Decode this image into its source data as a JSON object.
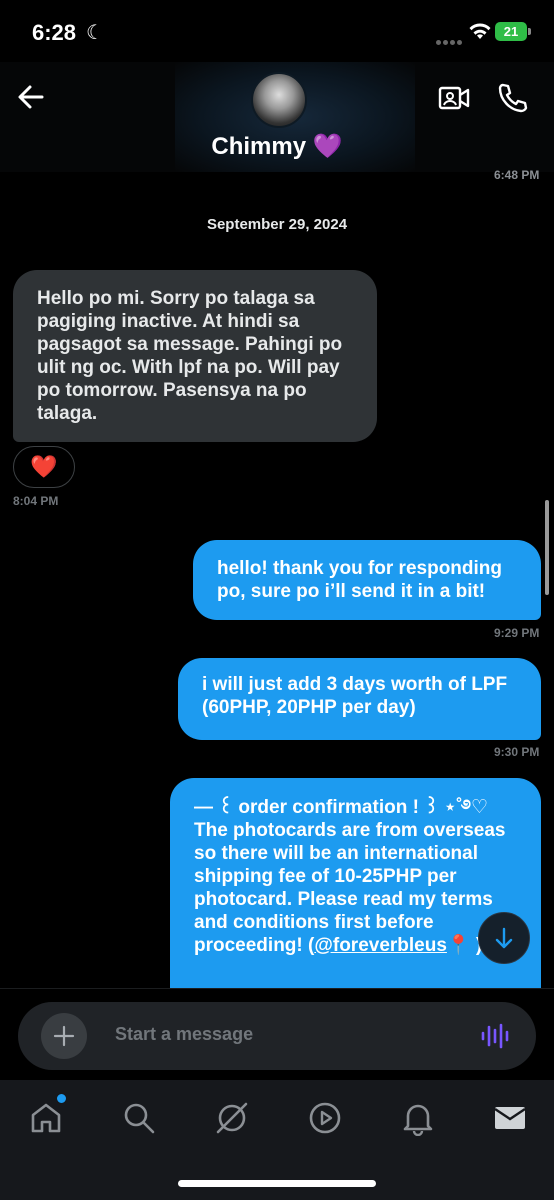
{
  "status_bar": {
    "time": "6:28",
    "moon_glyph": "☾",
    "battery": "21"
  },
  "header": {
    "contact_name": "Chimmy 💜",
    "prev_message_time": "6:48 PM",
    "icons": [
      "back-arrow-icon",
      "video-call-icon",
      "phone-call-icon"
    ]
  },
  "chat": {
    "date_separator": "September 29, 2024",
    "messages": [
      {
        "direction": "incoming",
        "text": "Hello po mi. Sorry po talaga sa pagiging inactive. At hindi sa pagsagot sa message. Pahingi po ulit ng oc. With lpf na po. Will pay po tomorrow. Pasensya na po talaga.",
        "reaction": "❤️",
        "time": "8:04 PM"
      },
      {
        "direction": "outgoing",
        "text": "hello! thank you for responding po, sure po i’ll send it in a bit!",
        "time": "9:29 PM"
      },
      {
        "direction": "outgoing",
        "text": "i will just add 3 days worth of LPF (60PHP, 20PHP per day)",
        "time": "9:30 PM"
      },
      {
        "direction": "outgoing",
        "text_before_link": "— ꒰ order confirmation ! ꒱ ⋆˚࿔♡ The photocards are from overseas so there will be an international shipping fee of 10-25PHP per photocard. Please read my terms and conditions first before proceeding! (",
        "link": "@foreverbleus",
        "text_after_link": "📍 )"
      }
    ]
  },
  "composer": {
    "placeholder": "Start a message"
  },
  "tabbar": {
    "items": [
      "home-icon",
      "search-icon",
      "grok-icon",
      "video-icon",
      "notifications-icon",
      "messages-icon"
    ]
  },
  "colors": {
    "outgoing_bubble": "#1d9bf0",
    "incoming_bubble": "#2f3336",
    "background": "#000000",
    "voice_accent": "#7856ff"
  }
}
